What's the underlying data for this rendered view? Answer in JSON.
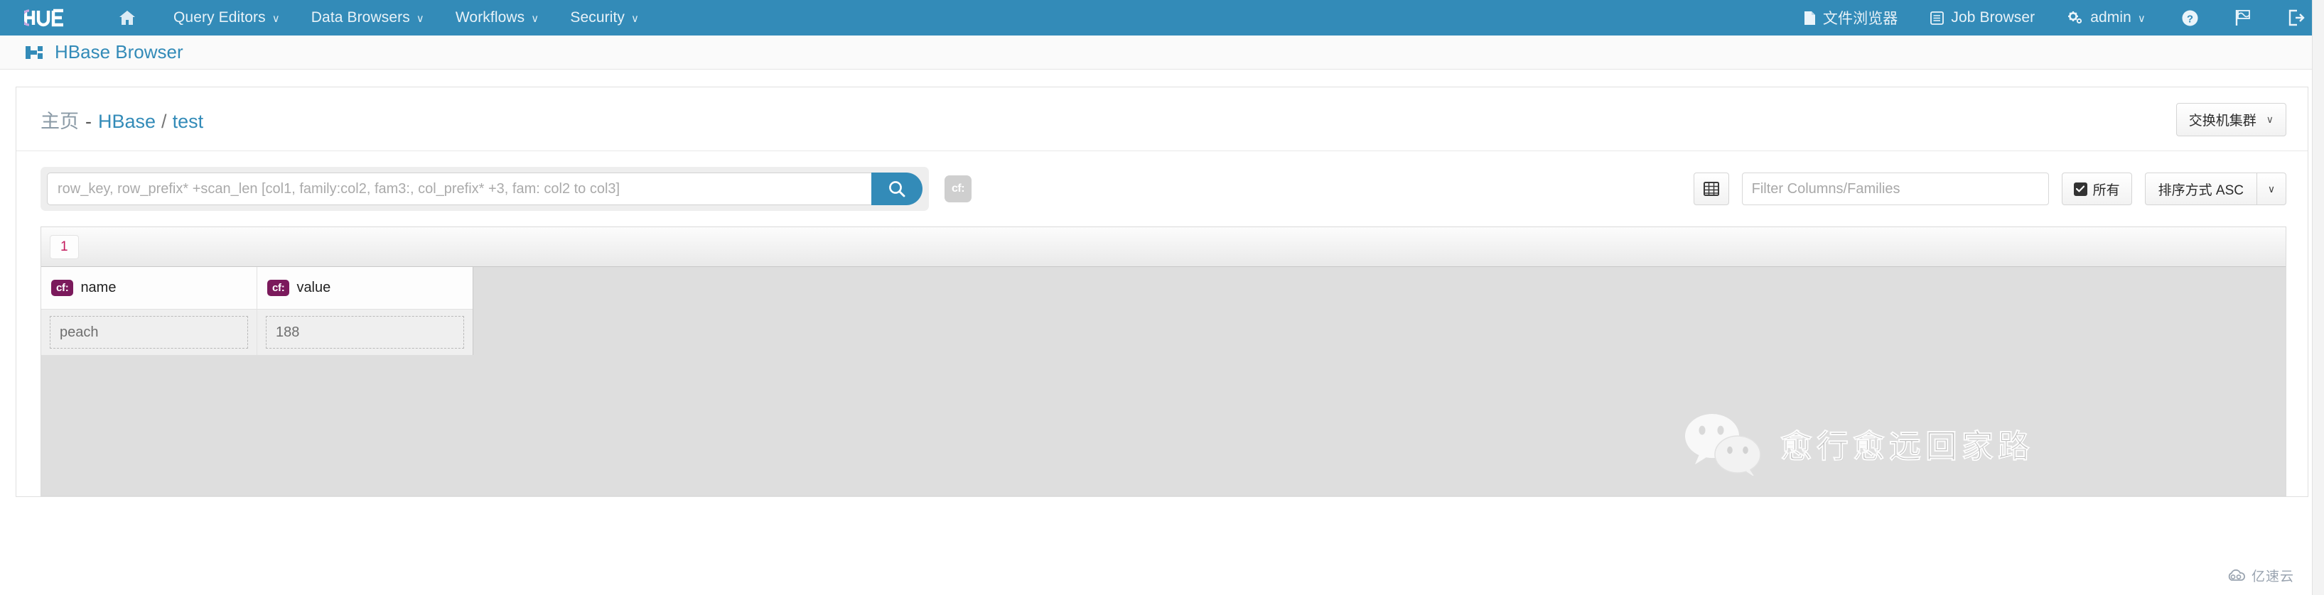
{
  "navbar": {
    "brand": "Hue",
    "brand_icon": "hue-logo-icon",
    "home_icon": "home-icon",
    "left_items": [
      {
        "label": "Query Editors",
        "caret": "∨"
      },
      {
        "label": "Data Browsers",
        "caret": "∨"
      },
      {
        "label": "Workflows",
        "caret": "∨"
      },
      {
        "label": "Security",
        "caret": "∨"
      }
    ],
    "right_items": [
      {
        "label": "文件浏览器",
        "icon": "file-icon"
      },
      {
        "label": "Job Browser",
        "icon": "list-icon"
      },
      {
        "label": "admin",
        "icon": "gears-icon",
        "caret": "∨"
      }
    ],
    "right_icons": [
      {
        "name": "help-icon",
        "glyph": "?"
      },
      {
        "name": "flag-icon",
        "glyph": "⚑"
      },
      {
        "name": "logout-icon",
        "glyph": "⇥"
      }
    ],
    "background_color": "#338bb8"
  },
  "page": {
    "app_title": "HBase Browser",
    "app_icon": "hbase-logo-icon",
    "title_color": "#338bb8"
  },
  "breadcrumb": {
    "home": "主页",
    "separator": "-",
    "cluster": "HBase",
    "slash": "/",
    "table": "test"
  },
  "cluster_button": {
    "label": "交换机集群",
    "caret": "∨"
  },
  "toolbar": {
    "search": {
      "value": "",
      "placeholder": "row_key, row_prefix* +scan_len [col1, family:col2, fam3:, col_prefix* +3, fam: col2 to col3]",
      "go_icon": "search-icon"
    },
    "cf_button": {
      "label": "cf:",
      "name": "column-family-toggle"
    },
    "grid_button": {
      "icon": "grid-icon"
    },
    "filter": {
      "value": "",
      "placeholder": "Filter Columns/Families"
    },
    "all_button": {
      "label": "所有",
      "checked": true,
      "check_glyph": "✔"
    },
    "sort_button": {
      "label": "排序方式 ASC",
      "caret": "∨"
    }
  },
  "results": {
    "row_key": "1",
    "row_key_color": "#c2185b",
    "columns": [
      {
        "family": "cf:",
        "name": "name"
      },
      {
        "family": "cf:",
        "name": "value"
      }
    ],
    "rows": [
      {
        "name": "peach",
        "value": "188"
      }
    ],
    "cf_badge_color": "#7b1a5c"
  },
  "watermarks": {
    "wechat_text": "愈行愈远回家路",
    "wechat_icon": "wechat-icon",
    "provider_text": "亿速云",
    "provider_icon": "cloud-icon"
  }
}
